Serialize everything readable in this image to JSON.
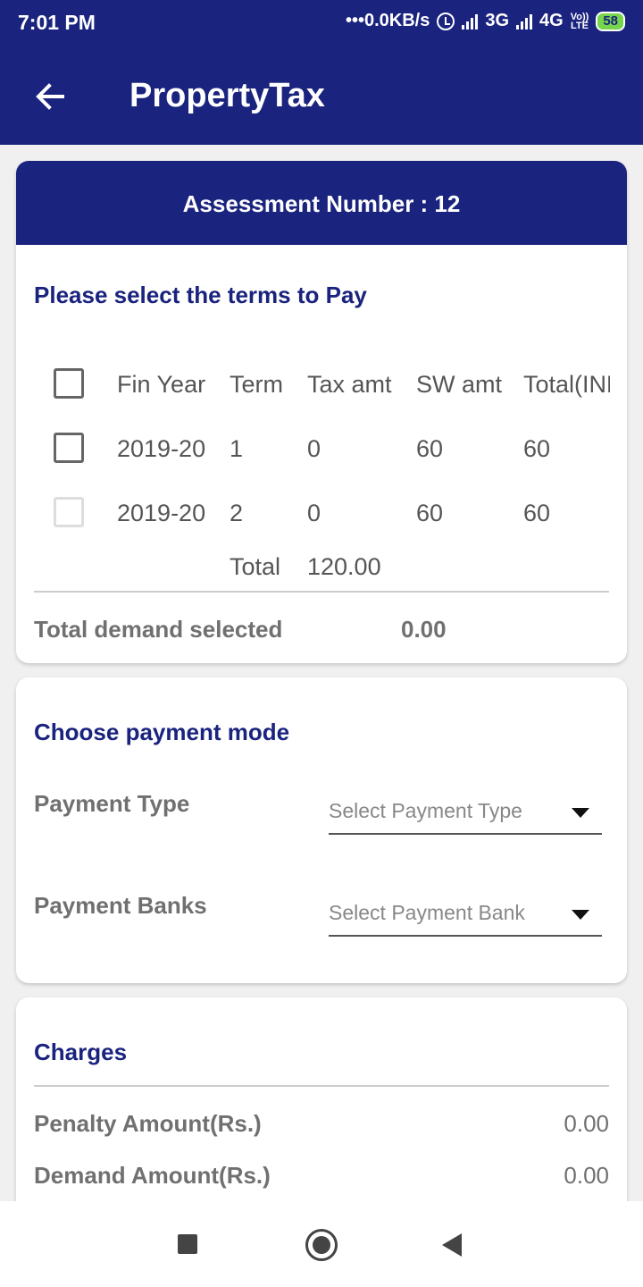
{
  "status_bar": {
    "time": "7:01 PM",
    "network_speed": "0.0KB/s",
    "network_1": "3G",
    "network_2": "4G",
    "volte_top": "Vo))",
    "volte_bottom": "LTE",
    "battery": "58"
  },
  "app_bar": {
    "title": "PropertyTax",
    "back_icon": "arrow-left-icon"
  },
  "terms_card": {
    "header": "Assessment Number : 12",
    "section_title": "Please select the terms to Pay",
    "columns": [
      "Fin Year",
      "Term",
      "Tax amt",
      "SW amt",
      "Total(INR)"
    ],
    "rows": [
      {
        "fin_year": "2019-20",
        "term": "1",
        "tax_amt": "0",
        "sw_amt": "60",
        "total": "60",
        "checked": false,
        "enabled": true
      },
      {
        "fin_year": "2019-20",
        "term": "2",
        "tax_amt": "0",
        "sw_amt": "60",
        "total": "60",
        "checked": false,
        "enabled": false
      }
    ],
    "total_label": "Total",
    "total_value": "120.00",
    "demand_label": "Total demand selected",
    "demand_value": "0.00"
  },
  "payment_card": {
    "section_title": "Choose payment mode",
    "payment_type_label": "Payment Type",
    "payment_type_placeholder": "Select Payment Type",
    "payment_bank_label": "Payment Banks",
    "payment_bank_placeholder": "Select Payment Bank"
  },
  "charges_card": {
    "section_title": "Charges",
    "items": [
      {
        "label": "Penalty Amount(Rs.)",
        "value": "0.00"
      },
      {
        "label": "Demand Amount(Rs.)",
        "value": "0.00"
      }
    ]
  },
  "colors": {
    "primary": "#1a237e",
    "text_gray": "#707070",
    "battery": "#76d44d"
  }
}
